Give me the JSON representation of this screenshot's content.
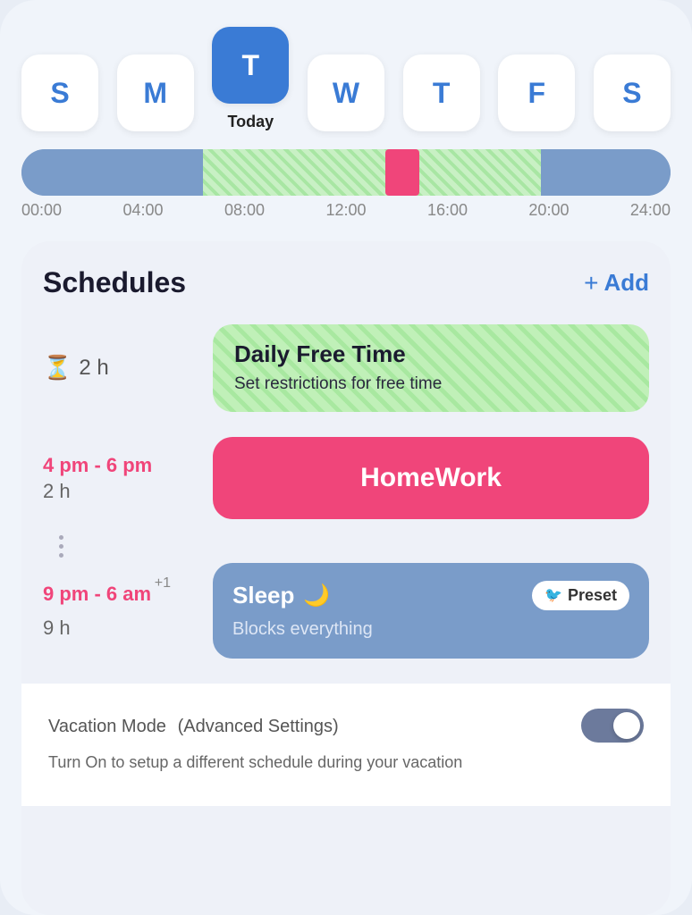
{
  "days": {
    "items": [
      {
        "label": "S",
        "active": false
      },
      {
        "label": "M",
        "active": false
      },
      {
        "label": "T",
        "active": true
      },
      {
        "label": "W",
        "active": false
      },
      {
        "label": "T",
        "active": false
      },
      {
        "label": "F",
        "active": false
      },
      {
        "label": "S",
        "active": false
      }
    ],
    "today_label": "Today"
  },
  "timeline": {
    "ticks": [
      "00:00",
      "04:00",
      "08:00",
      "12:00",
      "16:00",
      "20:00",
      "24:00"
    ]
  },
  "schedules": {
    "title": "Schedules",
    "add_label": "Add",
    "items": [
      {
        "duration_icon": "⏳",
        "duration": "2 h",
        "card_title": "Daily Free Time",
        "card_subtitle": "Set restrictions for free time",
        "type": "green"
      },
      {
        "time": "4 pm - 6 pm",
        "duration": "2 h",
        "card_title": "HomeWork",
        "type": "pink"
      },
      {
        "time": "9 pm - 6 am",
        "time_badge": "+1",
        "duration": "9 h",
        "card_title": "Sleep",
        "card_subtitle": "Blocks everything",
        "preset_label": "Preset",
        "type": "blue"
      }
    ]
  },
  "vacation": {
    "title": "Vacation Mode",
    "subtitle": "(Advanced Settings)",
    "description": "Turn On to setup a different schedule during your vacation"
  }
}
